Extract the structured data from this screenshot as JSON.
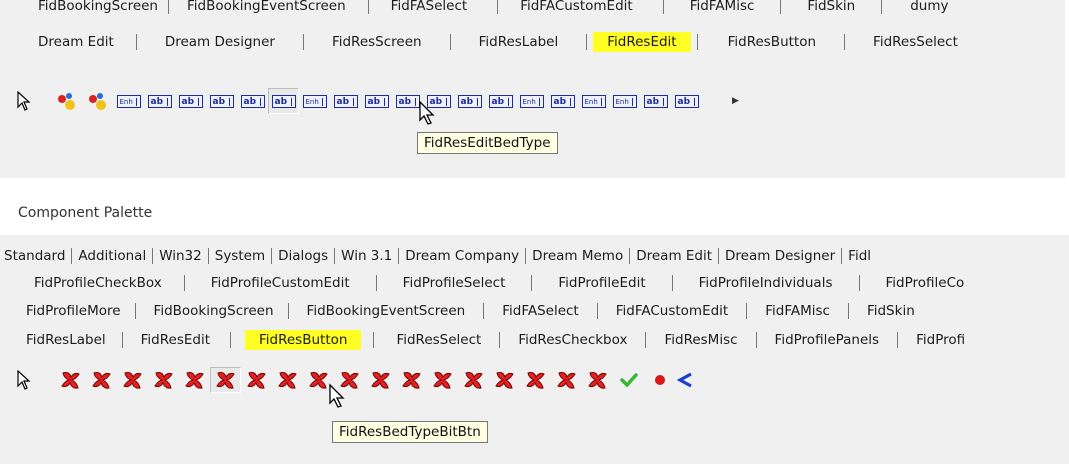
{
  "top": {
    "row1": [
      "FidBookingScreen",
      "FidBookingEventScreen",
      "FidFASelect",
      "FidFACustomEdit",
      "FidFAMisc",
      "FidSkin",
      "dumy"
    ],
    "row2": [
      "Dream Edit",
      "Dream Designer",
      "FidResScreen",
      "FidResLabel",
      "FidResEdit",
      "FidResButton",
      "FidResSelect"
    ],
    "selected_tab": "FidResEdit",
    "tooltip": "FidResEditBedType"
  },
  "bottom": {
    "caption": "Component Palette",
    "row1": [
      "Standard",
      "Additional",
      "Win32",
      "System",
      "Dialogs",
      "Win 3.1",
      "Dream Company",
      "Dream Memo",
      "Dream Edit",
      "Dream Designer",
      "Fidl"
    ],
    "row2": [
      "FidProfileCheckBox",
      "FidProfileCustomEdit",
      "FidProfileSelect",
      "FidProfileEdit",
      "FidProfileIndividuals",
      "FidProfileCo"
    ],
    "row3": [
      "FidProfileMore",
      "FidBookingScreen",
      "FidBookingEventScreen",
      "FidFASelect",
      "FidFACustomEdit",
      "FidFAMisc",
      "FidSkin"
    ],
    "row4": [
      "FidResLabel",
      "FidResEdit",
      "FidResButton",
      "FidResSelect",
      "FidResCheckbox",
      "FidResMisc",
      "FidProfilePanels",
      "FidProfi"
    ],
    "selected_tab": "FidResButton",
    "tooltip": "FidResBedTypeBitBtn"
  },
  "icons": {
    "edit_chip_text": "ab",
    "enh_chip_text": "Enh"
  },
  "colors": {
    "highlight": "#ffff25",
    "tooltip_bg": "#ffffe1",
    "panel_bg": "#f0f0f0"
  }
}
